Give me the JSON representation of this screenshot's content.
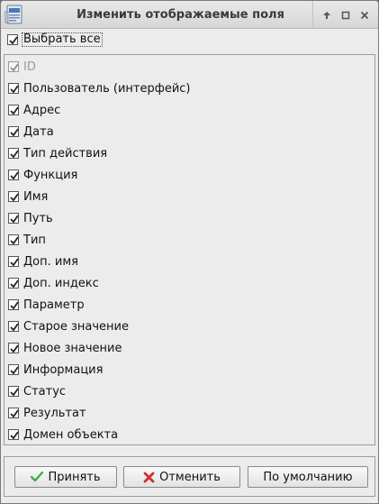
{
  "window": {
    "title": "Изменить отображаемые поля"
  },
  "select_all": {
    "label": "Выбрать все",
    "checked": true
  },
  "fields": [
    {
      "label": "ID",
      "checked": true,
      "disabled": true
    },
    {
      "label": "Пользователь (интерфейс)",
      "checked": true,
      "disabled": false
    },
    {
      "label": "Адрес",
      "checked": true,
      "disabled": false
    },
    {
      "label": "Дата",
      "checked": true,
      "disabled": false
    },
    {
      "label": "Тип действия",
      "checked": true,
      "disabled": false
    },
    {
      "label": "Функция",
      "checked": true,
      "disabled": false
    },
    {
      "label": "Имя",
      "checked": true,
      "disabled": false
    },
    {
      "label": "Путь",
      "checked": true,
      "disabled": false
    },
    {
      "label": "Тип",
      "checked": true,
      "disabled": false
    },
    {
      "label": "Доп. имя",
      "checked": true,
      "disabled": false
    },
    {
      "label": "Доп. индекс",
      "checked": true,
      "disabled": false
    },
    {
      "label": "Параметр",
      "checked": true,
      "disabled": false
    },
    {
      "label": "Старое значение",
      "checked": true,
      "disabled": false
    },
    {
      "label": "Новое значение",
      "checked": true,
      "disabled": false
    },
    {
      "label": "Информация",
      "checked": true,
      "disabled": false
    },
    {
      "label": "Статус",
      "checked": true,
      "disabled": false
    },
    {
      "label": "Результат",
      "checked": true,
      "disabled": false
    },
    {
      "label": "Домен объекта",
      "checked": true,
      "disabled": false
    }
  ],
  "buttons": {
    "accept": {
      "label": "Принять",
      "icon": "check-icon",
      "color": "#4caf50"
    },
    "cancel": {
      "label": "Отменить",
      "icon": "red-x-icon",
      "color": "#d32f2f"
    },
    "default": {
      "label": "По умолчанию"
    }
  }
}
